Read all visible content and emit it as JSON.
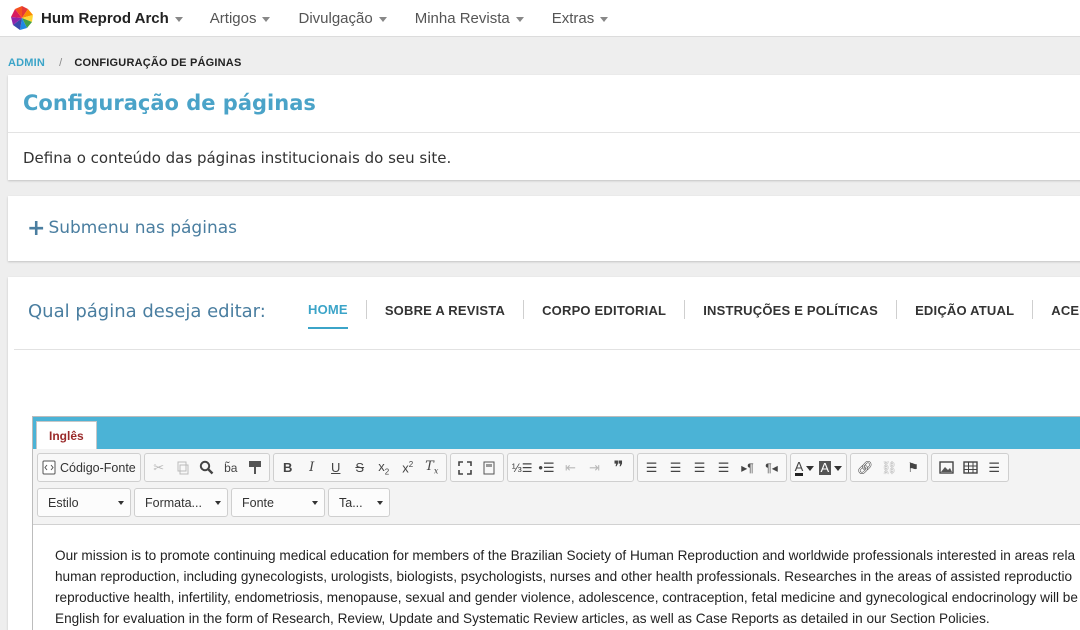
{
  "nav": {
    "brand": "Hum Reprod Arch",
    "items": [
      "Artigos",
      "Divulgação",
      "Minha Revista",
      "Extras"
    ]
  },
  "breadcrumb": {
    "root": "ADMIN",
    "separator": "/",
    "current": "CONFIGURAÇÃO DE PÁGINAS"
  },
  "page": {
    "title": "Configuração de páginas",
    "description": "Defina o conteúdo das páginas institucionais do seu site.",
    "submenu": "Submenu nas páginas",
    "question": "Qual página deseja editar:"
  },
  "tabs": [
    "HOME",
    "SOBRE A REVISTA",
    "CORPO EDITORIAL",
    "INSTRUÇÕES E POLÍTICAS",
    "EDIÇÃO ATUAL",
    "ACERVO"
  ],
  "active_tab": "HOME",
  "editor": {
    "language_tab": "Inglês",
    "source_label": "Código-Fonte",
    "selects": [
      "Estilo",
      "Formata...",
      "Fonte",
      "Ta..."
    ],
    "lines": [
      "Our mission is to promote continuing medical education for members of the Brazilian Society of Human Reproduction and worldwide professionals interested in areas rela",
      "human reproduction, including gynecologists, urologists, biologists, psychologists, nurses and other health professionals. Researches in the areas of assisted reproductio",
      "reproductive health, infertility, endometriosis, menopause, sexual and gender violence, adolescence, contraception, fetal medicine and gynecological endocrinology will be",
      "English for evaluation in the form of Research, Review, Update and Systematic Review articles, as well as Case Reports as detailed in our Section Policies."
    ]
  },
  "colors": {
    "accent": "#3ba4c8",
    "heading": "#4aa3c8",
    "secondary_heading": "#4a7ea0",
    "language_bar": "#4bb3d6",
    "language_tab_text": "#9a2a2a"
  }
}
